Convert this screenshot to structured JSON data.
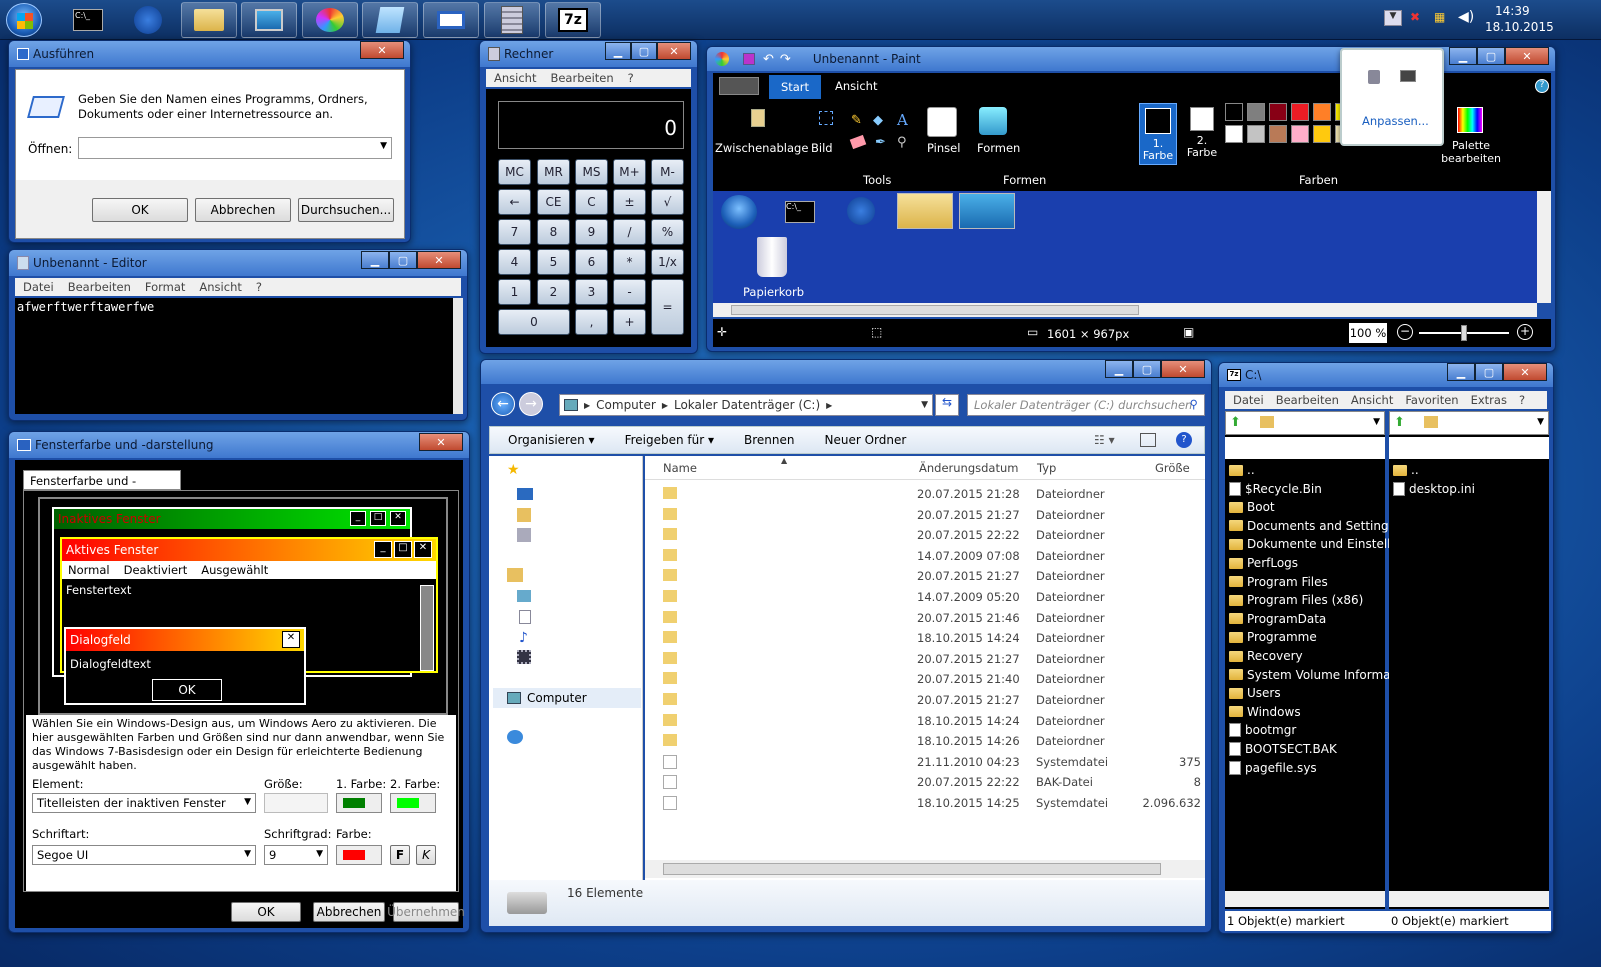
{
  "taskbar": {
    "time": "14:39",
    "date": "18.10.2015"
  },
  "run": {
    "title": "Ausführen",
    "description": "Geben Sie den Namen eines Programms, Ordners, Dokuments oder einer Internetressource an.",
    "open_label": "Öffnen:",
    "ok": "OK",
    "cancel": "Abbrechen",
    "browse": "Durchsuchen..."
  },
  "notepad": {
    "title": "Unbenannt - Editor",
    "menu": [
      "Datei",
      "Bearbeiten",
      "Format",
      "Ansicht",
      "?"
    ],
    "content": "afwerftwerftawerfwe"
  },
  "calc": {
    "title": "Rechner",
    "menu": [
      "Ansicht",
      "Bearbeiten",
      "?"
    ],
    "display": "0",
    "keys": [
      "MC",
      "MR",
      "MS",
      "M+",
      "M-",
      "←",
      "CE",
      "C",
      "±",
      "√",
      "7",
      "8",
      "9",
      "/",
      "%",
      "4",
      "5",
      "6",
      "*",
      "1/x",
      "1",
      "2",
      "3",
      "-",
      "=",
      "0",
      ",",
      "+"
    ]
  },
  "paint": {
    "title": "Unbenannt - Paint",
    "tabs": [
      "Start",
      "Ansicht"
    ],
    "clipboard": "Zwischenablage",
    "image": "Bild",
    "tools": "Tools",
    "brushes": "Pinsel",
    "shapes_btn": "Formen",
    "shapes": "Formen",
    "color1": "1. Farbe",
    "color2": "2. Farbe",
    "colors": "Farben",
    "edit_palette": "Palette bearbeiten",
    "size": "1601 × 967px",
    "zoom": "100 %",
    "recycle": "Papierkorb"
  },
  "tray_popup": {
    "customize": "Anpassen..."
  },
  "color_dialog": {
    "title": "Fensterfarbe und -darstellung",
    "tab": "Fensterfarbe und -darstellung",
    "inactive": "Inaktives Fenster",
    "active": "Aktives Fenster",
    "menu": [
      "Normal",
      "Deaktiviert",
      "Ausgewählt"
    ],
    "window_text": "Fenstertext",
    "dialog": "Dialogfeld",
    "dialog_text": "Dialogfeldtext",
    "ok_small": "OK",
    "info": "Wählen Sie ein Windows-Design aus, um Windows Aero zu aktivieren. Die hier ausgewählten Farben und Größen sind nur dann anwendbar, wenn Sie das Windows 7-Basisdesign oder ein Design für erleichterte Bedienung ausgewählt haben.",
    "element_label": "Element:",
    "element_value": "Titelleisten der inaktiven Fenster",
    "size_label": "Größe:",
    "color1_label": "1. Farbe:",
    "color2_label": "2. Farbe:",
    "font_label": "Schriftart:",
    "font_value": "Segoe UI",
    "fontsize_label": "Schriftgrad:",
    "fontsize_value": "9",
    "fontcolor_label": "Farbe:",
    "bold": "F",
    "italic": "K",
    "ok": "OK",
    "cancel": "Abbrechen",
    "apply": "Übernehmen"
  },
  "explorer": {
    "crumbs": [
      "Computer",
      "Lokaler Datenträger (C:)"
    ],
    "search_placeholder": "Lokaler Datenträger (C:) durchsuchen",
    "toolbar": [
      "Organisieren",
      "Freigeben für",
      "Brennen",
      "Neuer Ordner"
    ],
    "cols": [
      "Name",
      "Änderungsdatum",
      "Typ",
      "Größe"
    ],
    "nav_computer": "Computer",
    "status": "16 Elemente",
    "rows": [
      {
        "date": "20.07.2015 21:28",
        "type": "Dateiordner",
        "size": ""
      },
      {
        "date": "20.07.2015 21:27",
        "type": "Dateiordner",
        "size": ""
      },
      {
        "date": "20.07.2015 22:22",
        "type": "Dateiordner",
        "size": ""
      },
      {
        "date": "14.07.2009 07:08",
        "type": "Dateiordner",
        "size": ""
      },
      {
        "date": "20.07.2015 21:27",
        "type": "Dateiordner",
        "size": ""
      },
      {
        "date": "14.07.2009 05:20",
        "type": "Dateiordner",
        "size": ""
      },
      {
        "date": "20.07.2015 21:46",
        "type": "Dateiordner",
        "size": ""
      },
      {
        "date": "18.10.2015 14:24",
        "type": "Dateiordner",
        "size": ""
      },
      {
        "date": "20.07.2015 21:27",
        "type": "Dateiordner",
        "size": ""
      },
      {
        "date": "20.07.2015 21:40",
        "type": "Dateiordner",
        "size": ""
      },
      {
        "date": "20.07.2015 21:27",
        "type": "Dateiordner",
        "size": ""
      },
      {
        "date": "18.10.2015 14:24",
        "type": "Dateiordner",
        "size": ""
      },
      {
        "date": "18.10.2015 14:26",
        "type": "Dateiordner",
        "size": ""
      },
      {
        "date": "21.11.2010 04:23",
        "type": "Systemdatei",
        "size": "375"
      },
      {
        "date": "20.07.2015 22:22",
        "type": "BAK-Datei",
        "size": "8"
      },
      {
        "date": "18.10.2015 14:25",
        "type": "Systemdatei",
        "size": "2.096.632"
      }
    ]
  },
  "sevenzip": {
    "title": "C:\\",
    "menu": [
      "Datei",
      "Bearbeiten",
      "Ansicht",
      "Favoriten",
      "Extras",
      "?"
    ],
    "left": [
      "..",
      "$Recycle.Bin",
      "Boot",
      "Documents and Settings",
      "Dokumente und Einstell...",
      "PerfLogs",
      "Program Files",
      "Program Files (x86)",
      "ProgramData",
      "Programme",
      "Recovery",
      "System Volume Informa...",
      "Users",
      "Windows",
      "bootmgr",
      "BOOTSECT.BAK",
      "pagefile.sys"
    ],
    "right": [
      "..",
      "desktop.ini"
    ],
    "status_left": "1 Objekt(e) markiert",
    "status_right": "0 Objekt(e) markiert"
  }
}
